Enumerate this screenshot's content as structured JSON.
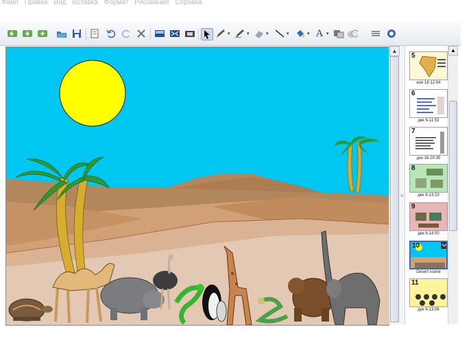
{
  "menu": [
    "Файл",
    "Правка",
    "Вид",
    "Вставка",
    "Формат",
    "Рисование",
    "Справка"
  ],
  "toolbar": [
    "back-page-icon",
    "forward-page-icon",
    "add-page-icon",
    "open-icon",
    "save-icon",
    "paste-icon",
    "undo-icon",
    "redo-icon",
    "delete-icon",
    "screen-shade-icon",
    "full-screen-icon",
    "capture-icon",
    "select-arrow-icon",
    "pen-icon",
    "creative-pen-icon",
    "eraser-icon",
    "line-icon",
    "fill-icon",
    "text-icon",
    "properties-icon",
    "gallery-icon",
    "more-icon",
    "help-icon"
  ],
  "pages": [
    {
      "num": "5",
      "caption": "ноя 18-12:54",
      "theme": "map",
      "selected": false
    },
    {
      "num": "6",
      "caption": "дек 6-11:53",
      "theme": "bars",
      "selected": false
    },
    {
      "num": "7",
      "caption": "дек 16-20:35",
      "theme": "text",
      "selected": false
    },
    {
      "num": "8",
      "caption": "дек 6-13:23",
      "theme": "green",
      "selected": false
    },
    {
      "num": "9",
      "caption": "дек 6-14:00",
      "theme": "red",
      "selected": false
    },
    {
      "num": "10",
      "caption": "Desert scene",
      "theme": "desert",
      "selected": true
    },
    {
      "num": "11",
      "caption": "дек 6-13:06",
      "theme": "yellow",
      "selected": false
    }
  ],
  "colors": {
    "sky": "#00c6f2",
    "sun": "#ffff00",
    "dune_far": "#b48457",
    "dune_mid": "#cfa073",
    "sand_front": "#dec4ac",
    "palm_leaf": "#2e9a2e",
    "palm_trunk": "#d8ad2e",
    "selection": "#2f6fd1"
  },
  "animals": [
    "tortoise",
    "camel",
    "hippo",
    "ostrich",
    "lizard",
    "penguin",
    "giraffe",
    "snake",
    "bear",
    "elephant"
  ]
}
